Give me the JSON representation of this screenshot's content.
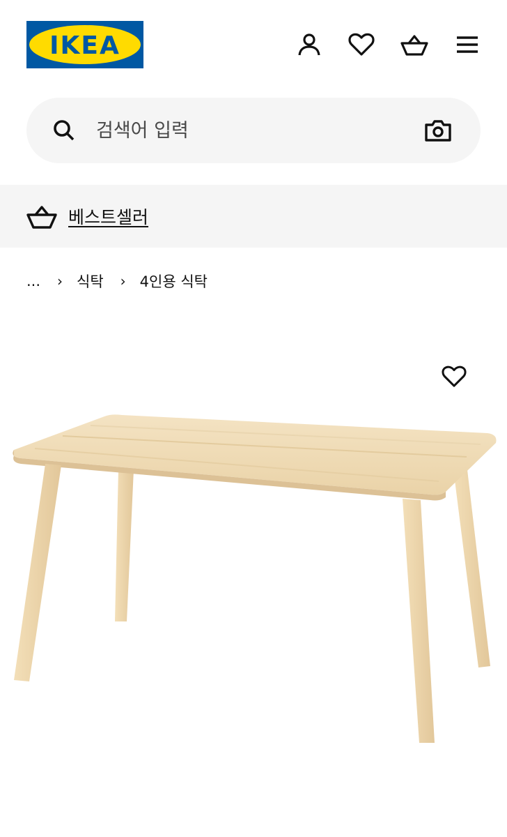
{
  "header": {
    "logo_text": "IKEA",
    "brand_colors": {
      "blue": "#0058a3",
      "yellow": "#ffdb00"
    },
    "icons": [
      "account-icon",
      "heart-icon",
      "basket-icon",
      "menu-icon"
    ]
  },
  "search": {
    "placeholder": "검색어 입력",
    "icons": [
      "search-icon",
      "camera-icon"
    ]
  },
  "banner": {
    "link_label": "베스트셀러",
    "icon": "basket-icon"
  },
  "breadcrumb": {
    "ellipsis": "...",
    "items": [
      "식탁",
      "4인용 식탁"
    ],
    "separator": "›"
  },
  "product": {
    "image_alt": "wooden-table",
    "wishlist_icon": "heart-icon"
  }
}
